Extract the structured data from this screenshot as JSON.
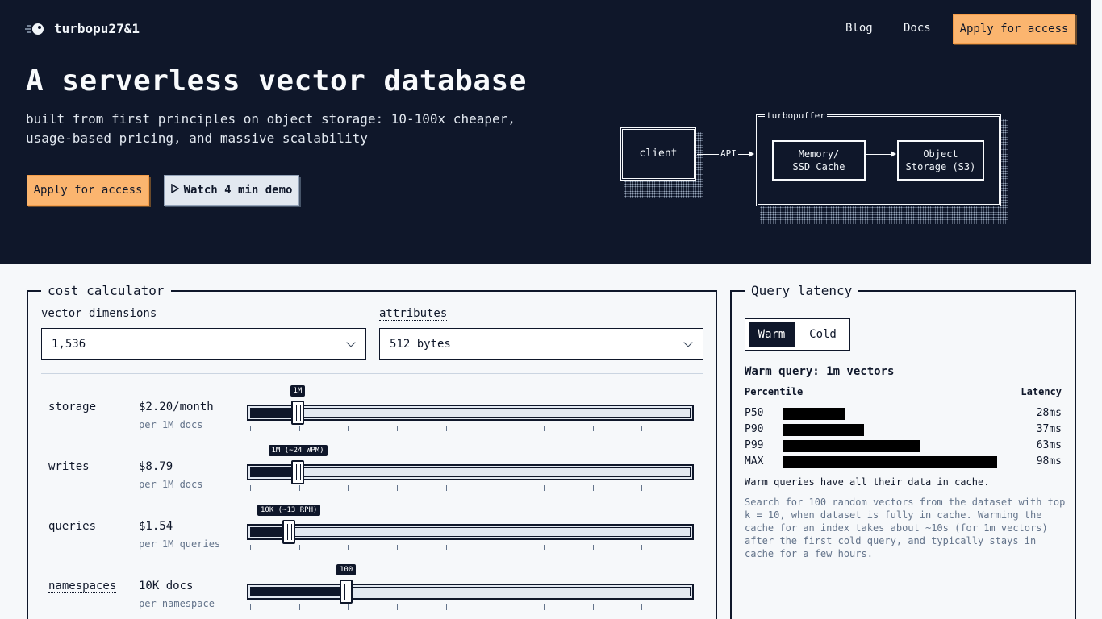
{
  "header": {
    "brand": "turbopu27&1",
    "nav": {
      "blog": "Blog",
      "docs": "Docs",
      "apply": "Apply for access"
    }
  },
  "hero": {
    "title": "A serverless vector database",
    "subtitle": "built from first principles on object storage: 10-100x cheaper, usage-based pricing, and massive scalability",
    "apply_label": "Apply for access",
    "demo_label": "Watch 4 min demo"
  },
  "diagram": {
    "client": "client",
    "api": "API",
    "group": "turbopuffer",
    "cache_line1": "Memory/",
    "cache_line2": "SSD Cache",
    "storage_line1": "Object",
    "storage_line2": "Storage (S3)"
  },
  "calculator": {
    "title": "cost calculator",
    "dimensions_label": "vector dimensions",
    "dimensions_value": "1,536",
    "attributes_label": "attributes",
    "attributes_value": "512 bytes",
    "rows": [
      {
        "name": "storage",
        "price": "$2.20/month",
        "unit": "per 1M docs",
        "tip": "1M",
        "level": 0.11
      },
      {
        "name": "writes",
        "price": "$8.79",
        "unit": "per 1M docs",
        "tip": "1M (~24 WPM)",
        "level": 0.11
      },
      {
        "name": "queries",
        "price": "$1.54",
        "unit": "per 1M queries",
        "tip": "10K (~13 RPH)",
        "level": 0.09
      },
      {
        "name": "namespaces",
        "price": "10K docs",
        "unit": "per namespace",
        "tip": "100",
        "level": 0.22
      }
    ]
  },
  "latency": {
    "title": "Query latency",
    "tab_warm": "Warm",
    "tab_cold": "Cold",
    "heading": "Warm query: 1m vectors",
    "col_percentile": "Percentile",
    "col_latency": "Latency",
    "rows": [
      {
        "label": "P50",
        "value": "28ms",
        "ms": 28
      },
      {
        "label": "P90",
        "value": "37ms",
        "ms": 37
      },
      {
        "label": "P99",
        "value": "63ms",
        "ms": 63
      },
      {
        "label": "MAX",
        "value": "98ms",
        "ms": 98
      }
    ],
    "note": "Warm queries have all their data in cache.",
    "description": "Search for 100 random vectors from the dataset with top k = 10, when dataset is fully in cache. Warming the cache for an index takes about ~10s (for 1m vectors) after the first cold query, and typically stays in cache for a few hours."
  },
  "colors": {
    "navy": "#0f172a",
    "accent": "#fbb56f",
    "muted": "#64748b"
  }
}
